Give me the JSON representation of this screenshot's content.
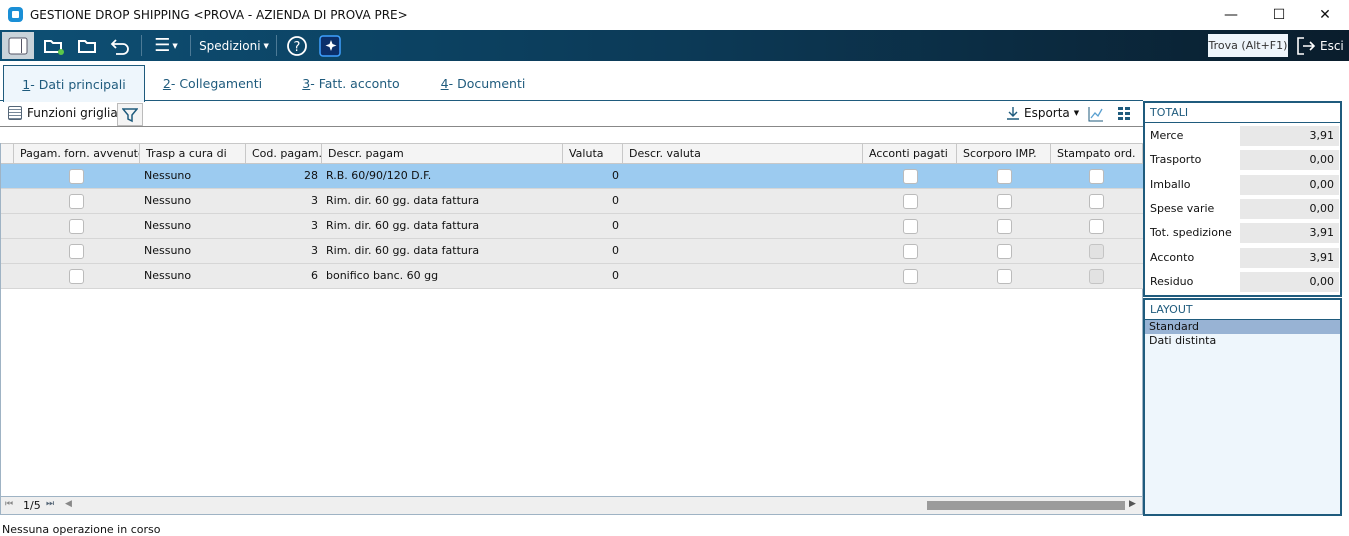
{
  "window": {
    "title": "GESTIONE DROP SHIPPING <PROVA - AZIENDA DI PROVA PRE>",
    "minimize": "—",
    "maximize": "☐",
    "close": "✕"
  },
  "toolbar": {
    "spedizioni": "Spedizioni",
    "find": "Trova (Alt+F1)",
    "exit": "Esci"
  },
  "tabs": [
    {
      "num": "1",
      "label": " - Dati principali"
    },
    {
      "num": "2",
      "label": " - Collegamenti"
    },
    {
      "num": "3",
      "label": " - Fatt. acconto"
    },
    {
      "num": "4",
      "label": " - Documenti"
    }
  ],
  "gridbar": {
    "functions": "Funzioni griglia",
    "export": "Esporta"
  },
  "columns": [
    "Pagam. forn. avvenuto",
    "Trasp a cura di",
    "Cod. pagam.",
    "Descr. pagam",
    "Valuta",
    "Descr. valuta",
    "Acconti pagati",
    "Scorporo IMP.",
    "Stampato ord."
  ],
  "rows": [
    {
      "trasp": "Nessuno",
      "cod": "28",
      "descr": "R.B. 60/90/120 D.F.",
      "valuta": "0",
      "descr_valuta": "",
      "stampato_disabled": false,
      "selected": true
    },
    {
      "trasp": "Nessuno",
      "cod": "3",
      "descr": "Rim. dir. 60 gg. data fattura",
      "valuta": "0",
      "descr_valuta": "",
      "stampato_disabled": false
    },
    {
      "trasp": "Nessuno",
      "cod": "3",
      "descr": "Rim. dir. 60 gg. data fattura",
      "valuta": "0",
      "descr_valuta": "",
      "stampato_disabled": false
    },
    {
      "trasp": "Nessuno",
      "cod": "3",
      "descr": "Rim. dir. 60 gg. data fattura",
      "valuta": "0",
      "descr_valuta": "",
      "stampato_disabled": true
    },
    {
      "trasp": "Nessuno",
      "cod": "6",
      "descr": "bonifico banc. 60 gg",
      "valuta": "0",
      "descr_valuta": "",
      "stampato_disabled": true
    }
  ],
  "pager": "1/5",
  "status": "Nessuna operazione in corso",
  "totali": {
    "title": "TOTALI",
    "items": [
      {
        "label": "Merce",
        "value": "3,91"
      },
      {
        "label": "Trasporto",
        "value": "0,00"
      },
      {
        "label": "Imballo",
        "value": "0,00"
      },
      {
        "label": "Spese varie",
        "value": "0,00"
      },
      {
        "label": "Tot. spedizione",
        "value": "3,91"
      },
      {
        "label": "Acconto",
        "value": "3,91"
      },
      {
        "label": "Residuo",
        "value": "0,00"
      }
    ]
  },
  "layout": {
    "title": "LAYOUT",
    "items": [
      "Standard",
      "Dati distinta"
    ],
    "selected": 0
  }
}
